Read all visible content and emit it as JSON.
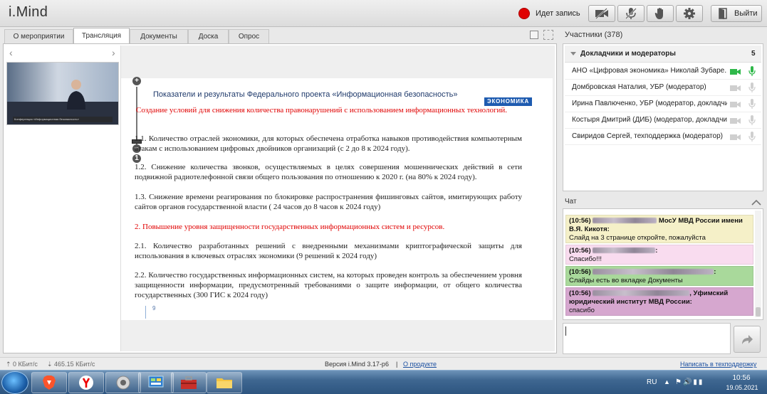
{
  "header": {
    "logo": "i.Mind",
    "recording_label": "Идет запись",
    "exit_label": "Выйти",
    "icons": [
      "camera-off-icon",
      "mic-off-icon",
      "hand-icon",
      "gear-icon",
      "exit-door-icon"
    ],
    "accent_color": "#e00000"
  },
  "tabs": {
    "event": "О мероприятии",
    "broadcast": "Трансляция",
    "documents": "Документы",
    "board": "Доска",
    "poll": "Опрос"
  },
  "broadcast": {
    "video_caption": "Конференция «Информационная безопасность»",
    "slide": {
      "title": "Показатели и результаты Федерального проекта «Информационная безопасность»",
      "logo": "ЭКОНОМИКА",
      "p0": "Создание условий для снижения количества правонарушений с использованием информационных технологий.",
      "p11": "1.1. Количество отраслей экономики, для которых обеспечена отработка навыков противодействия компьютерным атакам с использованием цифровых двойников организаций (с 2 до 8 к 2024 году).",
      "p12": "1.2. Снижение количества звонков, осуществляемых в целях совершения мошеннических действий в сети подвижной радиотелефонной связи общего пользования по отношению к 2020 г. (на 80% к 2024 году).",
      "p13": "1.3. Снижение времени реагирования по блокировке распространения фишинговых сайтов, имитирующих работу сайтов органов государственной власти ( 24 часов до 8 часов к 2024 году)",
      "p2h": "2. Повышение уровня защищенности государственных информационных систем и ресурсов.",
      "p21": "2.1. Количество разработанных решений с внедренными механизмами криптографической защиты для использования в ключевых отраслях экономики (9 решений к 2024 году)",
      "p22": "2.2. Количество государственных информационных систем, на которых проведен контроль за обеспечением уровня защищенности информации, предусмотренный требованиями о защите информации, от общего количества государственных (300 ГИС к 2024 году)",
      "page_number": "9"
    }
  },
  "participants": {
    "title": "Участники (378)",
    "group_label": "Докладчики и модераторы",
    "group_count": "5",
    "rows": [
      {
        "name": "АНО «Цифровая экономика» Николай Зубаре...",
        "active": true
      },
      {
        "name": "Домбровская Наталия, УБР (модератор)",
        "active": false
      },
      {
        "name": "Ирина Павлюченко, УБР (модератор, докладчик)",
        "active": false
      },
      {
        "name": "Костыря Дмитрий (ДИБ) (модератор, докладчик)",
        "active": false
      },
      {
        "name": "Свиридов Сергей, техподдержка (модератор)",
        "active": false
      }
    ]
  },
  "chat": {
    "title": "Чат",
    "messages": [
      {
        "time": "(10:56)",
        "author": "МосУ МВД России имени В.Я. Кикотя:",
        "text": "Слайд на 3 странице откройте, пожалуйста"
      },
      {
        "time": "(10:56)",
        "author": ":",
        "text": "Спасибо!!!"
      },
      {
        "time": "(10:56)",
        "author": ":",
        "text": "Слайды есть во вкладке Документы"
      },
      {
        "time": "(10:56)",
        "author": ", Уфимский юридический институт МВД России:",
        "text": "спасибо"
      }
    ]
  },
  "status": {
    "upload": "0 КБит/с",
    "download": "465.15 КБит/с",
    "version": "Версия i.Mind 3.17-p6",
    "separator": "|",
    "about": "О продукте",
    "support": "Написать в техподдержку"
  },
  "taskbar": {
    "lang": "RU",
    "time": "10:56",
    "date": "19.05.2021"
  }
}
